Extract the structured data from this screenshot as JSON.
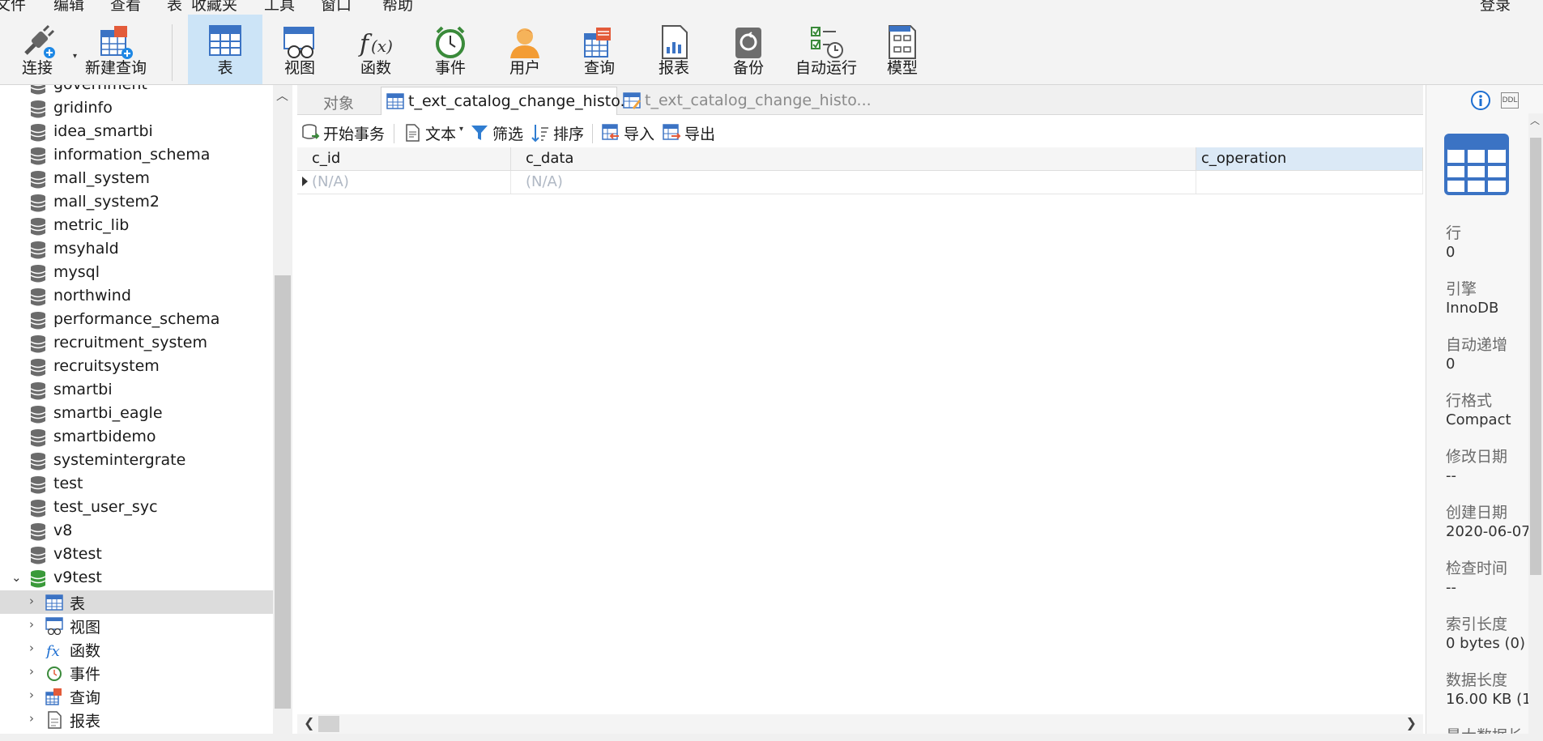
{
  "menubar": {
    "items": [
      "文件",
      "编辑",
      "查看",
      "表",
      "收藏夹",
      "工具",
      "窗口",
      "帮助"
    ],
    "login": "登录"
  },
  "toolbar": {
    "tools": [
      {
        "label": "连接",
        "icon": "connect-plug-icon"
      },
      {
        "label": "新建查询",
        "icon": "new-query-icon"
      },
      {
        "label": "表",
        "icon": "table-icon"
      },
      {
        "label": "视图",
        "icon": "view-glasses-icon"
      },
      {
        "label": "函数",
        "icon": "function-fx-icon"
      },
      {
        "label": "事件",
        "icon": "event-clock-icon"
      },
      {
        "label": "用户",
        "icon": "user-icon"
      },
      {
        "label": "查询",
        "icon": "query-icon"
      },
      {
        "label": "报表",
        "icon": "report-icon"
      },
      {
        "label": "备份",
        "icon": "backup-icon"
      },
      {
        "label": "自动运行",
        "icon": "automation-icon"
      },
      {
        "label": "模型",
        "icon": "model-icon"
      }
    ],
    "active": "表"
  },
  "tree": {
    "databases": [
      "government",
      "gridinfo",
      "idea_smartbi",
      "information_schema",
      "mall_system",
      "mall_system2",
      "metric_lib",
      "msyhald",
      "mysql",
      "northwind",
      "performance_schema",
      "recruitment_system",
      "recruitsystem",
      "smartbi",
      "smartbi_eagle",
      "smartbidemo",
      "systemintergrate",
      "test",
      "test_user_syc",
      "v8",
      "v8test",
      "v9test"
    ],
    "expanded_db": "v9test",
    "children": [
      {
        "label": "表",
        "icon": "table-icon",
        "selected": true
      },
      {
        "label": "视图",
        "icon": "view-icon",
        "selected": false
      },
      {
        "label": "函数",
        "icon": "function-icon",
        "selected": false
      },
      {
        "label": "事件",
        "icon": "event-icon",
        "selected": false
      },
      {
        "label": "查询",
        "icon": "query-icon",
        "selected": false
      },
      {
        "label": "报表",
        "icon": "report-icon",
        "selected": false
      }
    ]
  },
  "tabs": {
    "objects": "对象",
    "tab1": "t_ext_catalog_change_histo...",
    "tab2": "t_ext_catalog_change_histo..."
  },
  "subtoolbar": {
    "begin_transaction": "开始事务",
    "text": "文本",
    "filter": "筛选",
    "sort": "排序",
    "import": "导入",
    "export": "导出"
  },
  "grid": {
    "columns": [
      "c_id",
      "c_data",
      "c_operation"
    ],
    "rows": [
      [
        "(N/A)",
        "(N/A)",
        ""
      ]
    ]
  },
  "info_panel": {
    "fields": [
      {
        "label": "行",
        "value": "0"
      },
      {
        "label": "引擎",
        "value": "InnoDB"
      },
      {
        "label": "自动递增",
        "value": "0"
      },
      {
        "label": "行格式",
        "value": "Compact"
      },
      {
        "label": "修改日期",
        "value": "--"
      },
      {
        "label": "创建日期",
        "value": "2020-06-07"
      },
      {
        "label": "检查时间",
        "value": "--"
      },
      {
        "label": "索引长度",
        "value": "0 bytes (0)"
      },
      {
        "label": "数据长度",
        "value": "16.00 KB (16"
      },
      {
        "label": "最大数据长",
        "value": ""
      }
    ],
    "ddl_label": "DDL"
  }
}
